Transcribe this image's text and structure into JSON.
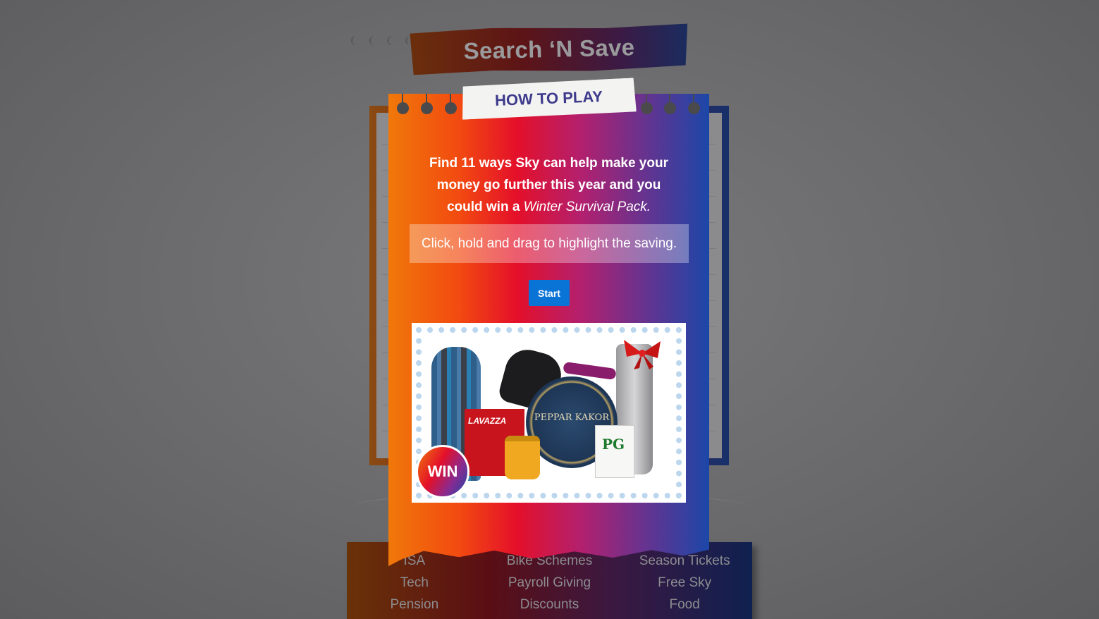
{
  "game": {
    "title": "Search ‘N Save"
  },
  "modal": {
    "heading": "HOW TO PLAY",
    "intro_part1": "Find 11 ways Sky can help make your money go further this year and you could win a ",
    "intro_emphasis": "Winter Survival Pack",
    "intro_end": ".",
    "instruction": "Click, hold and drag to highlight the saving.",
    "start_label": "Start"
  },
  "prize": {
    "badge": "WIN",
    "product_labels": {
      "tin": "PEPPAR KAKOR",
      "coffee": "LAVAZZA",
      "tea": "PG"
    }
  },
  "categories": [
    "ISA",
    "Bike Schemes",
    "Season Tickets",
    "Tech",
    "Payroll Giving",
    "Free Sky",
    "Pension",
    "Discounts",
    "Food"
  ],
  "colors": {
    "start_button": "#0a74d6",
    "heading_text": "#3d3a8c",
    "gradient": [
      "#f0780a",
      "#e4102a",
      "#b3206e",
      "#66338f",
      "#1c47a8"
    ]
  }
}
